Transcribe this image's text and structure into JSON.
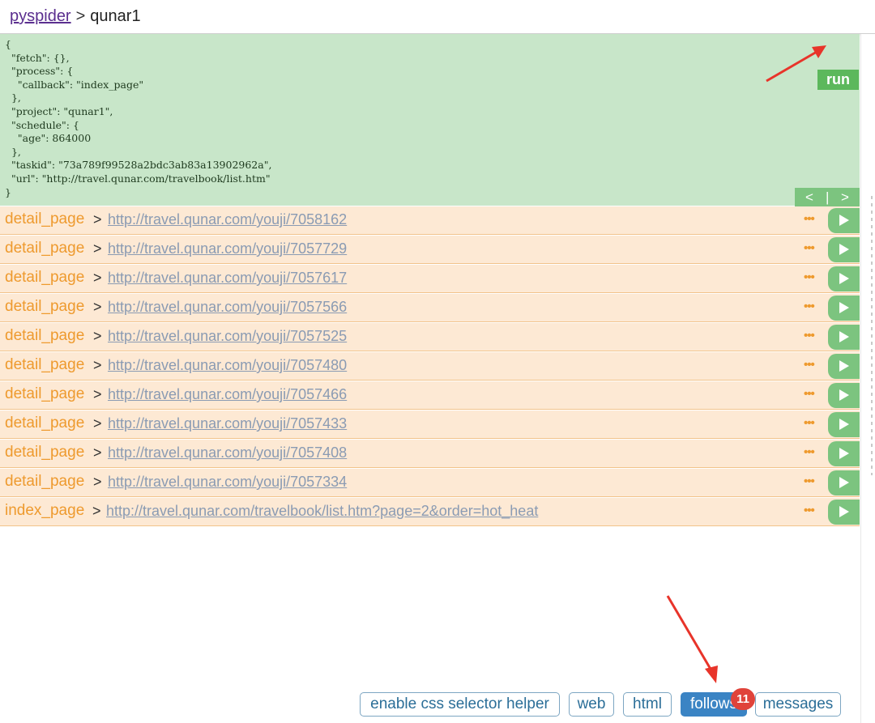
{
  "breadcrumb": {
    "root": "pyspider",
    "separator": ">",
    "project": "qunar1"
  },
  "task": {
    "json": "{\n  \"fetch\": {},\n  \"process\": {\n    \"callback\": \"index_page\"\n  },\n  \"project\": \"qunar1\",\n  \"schedule\": {\n    \"age\": 864000\n  },\n  \"taskid\": \"73a789f99528a2bdc3ab83a13902962a\",\n  \"url\": \"http://travel.qunar.com/travelbook/list.htm\"\n}",
    "run_label": "run"
  },
  "pager": {
    "prev": "<",
    "divider": "|",
    "next": ">"
  },
  "follows": [
    {
      "callback": "detail_page",
      "sep": ">",
      "url": "http://travel.qunar.com/youji/7058162",
      "more": "•••"
    },
    {
      "callback": "detail_page",
      "sep": ">",
      "url": "http://travel.qunar.com/youji/7057729",
      "more": "•••"
    },
    {
      "callback": "detail_page",
      "sep": ">",
      "url": "http://travel.qunar.com/youji/7057617",
      "more": "•••"
    },
    {
      "callback": "detail_page",
      "sep": ">",
      "url": "http://travel.qunar.com/youji/7057566",
      "more": "•••"
    },
    {
      "callback": "detail_page",
      "sep": ">",
      "url": "http://travel.qunar.com/youji/7057525",
      "more": "•••"
    },
    {
      "callback": "detail_page",
      "sep": ">",
      "url": "http://travel.qunar.com/youji/7057480",
      "more": "•••"
    },
    {
      "callback": "detail_page",
      "sep": ">",
      "url": "http://travel.qunar.com/youji/7057466",
      "more": "•••"
    },
    {
      "callback": "detail_page",
      "sep": ">",
      "url": "http://travel.qunar.com/youji/7057433",
      "more": "•••"
    },
    {
      "callback": "detail_page",
      "sep": ">",
      "url": "http://travel.qunar.com/youji/7057408",
      "more": "•••"
    },
    {
      "callback": "detail_page",
      "sep": ">",
      "url": "http://travel.qunar.com/youji/7057334",
      "more": "•••"
    },
    {
      "callback": "index_page",
      "sep": ">",
      "url": "http://travel.qunar.com/travelbook/list.htm?page=2&order=hot_heat",
      "more": "•••"
    }
  ],
  "tabs": {
    "css_helper": "enable css selector helper",
    "web": "web",
    "html": "html",
    "follows": "follows",
    "follows_count": "11",
    "messages": "messages"
  },
  "colors": {
    "task_bg": "#c8e6c9",
    "run_button": "#5cb85c",
    "row_bg": "#fde9d4",
    "callback_text": "#ee9a2e",
    "active_tab": "#3b84c4",
    "badge": "#e0433a",
    "annotation_arrow": "#e8342a"
  },
  "icons": {
    "row_action": "play-icon",
    "row_menu": "ellipsis-icon",
    "annotation": "arrow-icon"
  }
}
